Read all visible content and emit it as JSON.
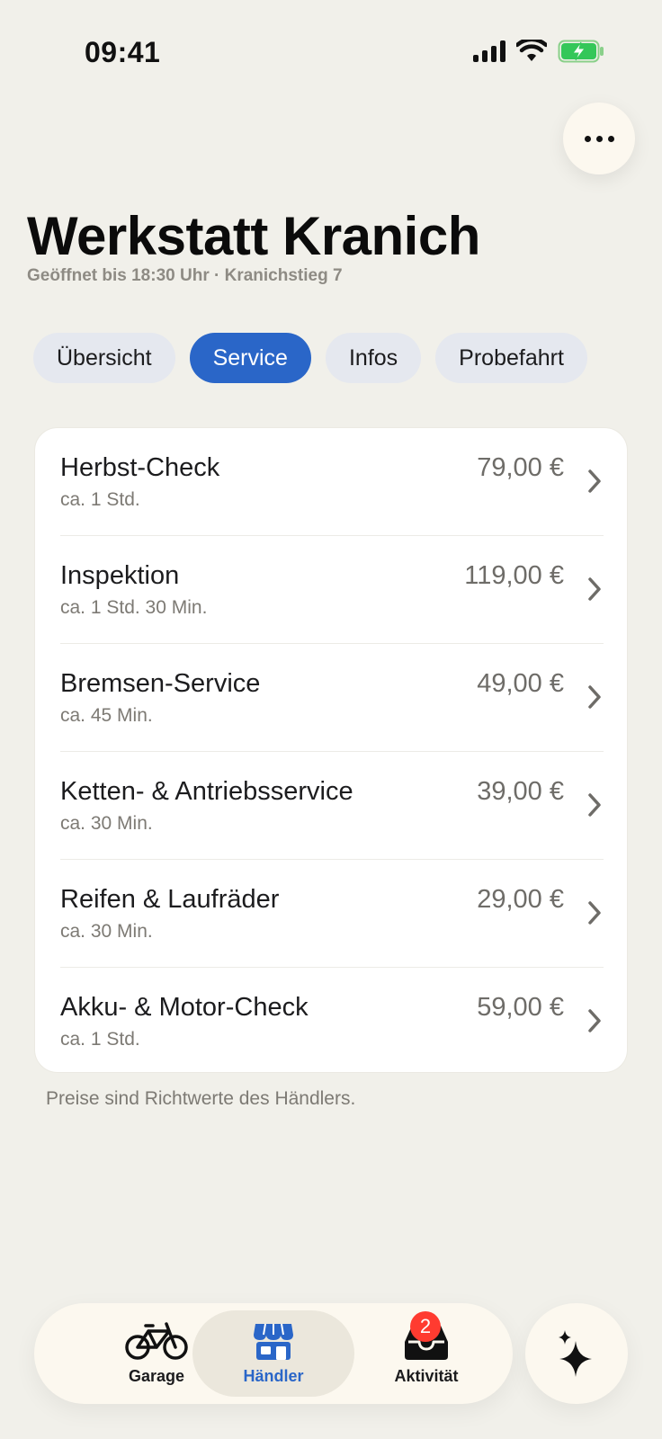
{
  "status_bar": {
    "time": "09:41"
  },
  "header": {
    "title": "Werkstatt Kranich",
    "subtitle": "Geöffnet bis 18:30 Uhr · Kranichstieg 7"
  },
  "tabs": [
    {
      "label": "Übersicht",
      "active": false
    },
    {
      "label": "Service",
      "active": true
    },
    {
      "label": "Infos",
      "active": false
    },
    {
      "label": "Probefahrt",
      "active": false
    }
  ],
  "services": [
    {
      "name": "Herbst-Check",
      "duration": "ca. 1 Std.",
      "price": "79,00 €"
    },
    {
      "name": "Inspektion",
      "duration": "ca. 1 Std. 30 Min.",
      "price": "119,00 €"
    },
    {
      "name": "Bremsen-Service",
      "duration": "ca. 45 Min.",
      "price": "49,00 €"
    },
    {
      "name": "Ketten- & Antriebsservice",
      "duration": "ca. 30 Min.",
      "price": "39,00 €"
    },
    {
      "name": "Reifen & Laufräder",
      "duration": "ca. 30 Min.",
      "price": "29,00 €"
    },
    {
      "name": "Akku- & Motor-Check",
      "duration": "ca. 1 Std.",
      "price": "59,00 €"
    }
  ],
  "footnote": "Preise sind Richtwerte des Händlers.",
  "tabbar": {
    "items": [
      {
        "label": "Garage",
        "icon": "bicycle-icon"
      },
      {
        "label": "Händler",
        "icon": "store-icon",
        "active": true
      },
      {
        "label": "Aktivität",
        "icon": "inbox-icon",
        "badge": "2"
      }
    ]
  },
  "colors": {
    "accent": "#2a66c8",
    "background": "#f1f0ea",
    "badge": "#ff3b30"
  }
}
